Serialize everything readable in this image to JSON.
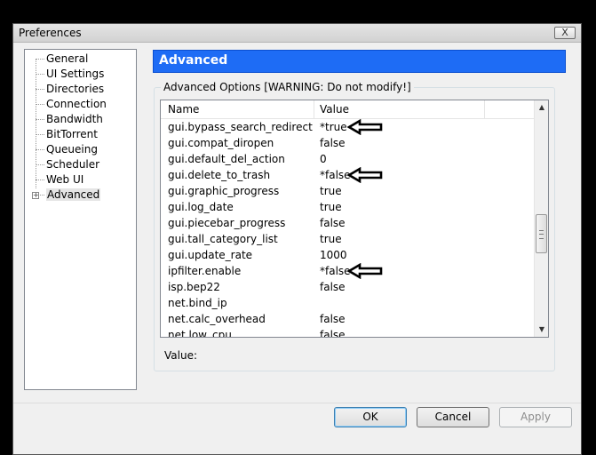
{
  "window": {
    "title": "Preferences",
    "close_label": "X"
  },
  "sidebar": {
    "items": [
      {
        "label": "General"
      },
      {
        "label": "UI Settings"
      },
      {
        "label": "Directories"
      },
      {
        "label": "Connection"
      },
      {
        "label": "Bandwidth"
      },
      {
        "label": "BitTorrent"
      },
      {
        "label": "Queueing"
      },
      {
        "label": "Scheduler"
      },
      {
        "label": "Web UI"
      },
      {
        "label": "Advanced",
        "selected": true,
        "expandable": true
      }
    ]
  },
  "panel": {
    "title": "Advanced",
    "group_label": "Advanced Options [WARNING: Do not modify!]",
    "columns": {
      "name": "Name",
      "value": "Value"
    },
    "rows": [
      {
        "name": "gui.bypass_search_redirect",
        "value": "*true",
        "marked": true
      },
      {
        "name": "gui.compat_diropen",
        "value": "false"
      },
      {
        "name": "gui.default_del_action",
        "value": "0"
      },
      {
        "name": "gui.delete_to_trash",
        "value": "*false",
        "marked": true
      },
      {
        "name": "gui.graphic_progress",
        "value": "true"
      },
      {
        "name": "gui.log_date",
        "value": "true"
      },
      {
        "name": "gui.piecebar_progress",
        "value": "false"
      },
      {
        "name": "gui.tall_category_list",
        "value": "true"
      },
      {
        "name": "gui.update_rate",
        "value": "1000"
      },
      {
        "name": "ipfilter.enable",
        "value": "*false",
        "marked": true
      },
      {
        "name": "isp.bep22",
        "value": "false"
      },
      {
        "name": "net.bind_ip",
        "value": ""
      },
      {
        "name": "net.calc_overhead",
        "value": "false"
      },
      {
        "name": "net.low_cpu",
        "value": "false"
      }
    ],
    "value_label": "Value:"
  },
  "buttons": {
    "ok": "OK",
    "cancel": "Cancel",
    "apply": "Apply"
  }
}
